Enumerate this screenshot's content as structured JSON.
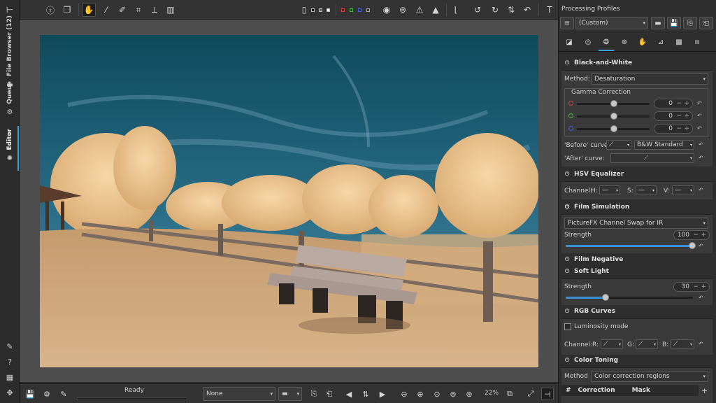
{
  "left_tabs": {
    "file_browser": "File Browser (12)",
    "queue": "Queue",
    "editor": "Editor"
  },
  "right_panel": {
    "title": "Processing Profiles",
    "profile_select": "(Custom)"
  },
  "black_and_white": {
    "title": "Black-and-White",
    "method_label": "Method:",
    "method_value": "Desaturation",
    "gamma_title": "Gamma Correction",
    "gamma_r": "0",
    "gamma_g": "0",
    "gamma_b": "0",
    "before_curve_label": "'Before' curve:",
    "before_curve_value": "B&W Standard",
    "after_curve_label": "'After' curve:"
  },
  "hsv": {
    "title": "HSV Equalizer",
    "channel_label": "Channel:",
    "h_label": "H:",
    "s_label": "S:",
    "v_label": "V:",
    "dash": "—"
  },
  "film_simulation": {
    "title": "Film Simulation",
    "value": "PictureFX Channel Swap for IR",
    "strength_label": "Strength",
    "strength_value": "100"
  },
  "film_negative": {
    "title": "Film Negative"
  },
  "soft_light": {
    "title": "Soft Light",
    "strength_label": "Strength",
    "strength_value": "30"
  },
  "rgb_curves": {
    "title": "RGB Curves",
    "luminosity_label": "Luminosity mode",
    "channel_label": "Channel:",
    "r_label": "R:",
    "g_label": "G:",
    "b_label": "B:"
  },
  "color_toning": {
    "title": "Color Toning",
    "method_label": "Method",
    "method_value": "Color correction regions",
    "col_hash": "#",
    "col_correction": "Correction",
    "col_mask": "Mask",
    "add": "+"
  },
  "bottom_bar": {
    "status": "Ready",
    "none_select": "None",
    "zoom": "22%"
  },
  "icons": {
    "power": "⏻",
    "minus": "−",
    "plus": "+",
    "reset": "↶",
    "caret": "▾"
  },
  "colors": {
    "accent": "#3a8ed8",
    "red_dot": "#d84040",
    "green_dot": "#40c040",
    "blue_dot": "#4060e0"
  }
}
